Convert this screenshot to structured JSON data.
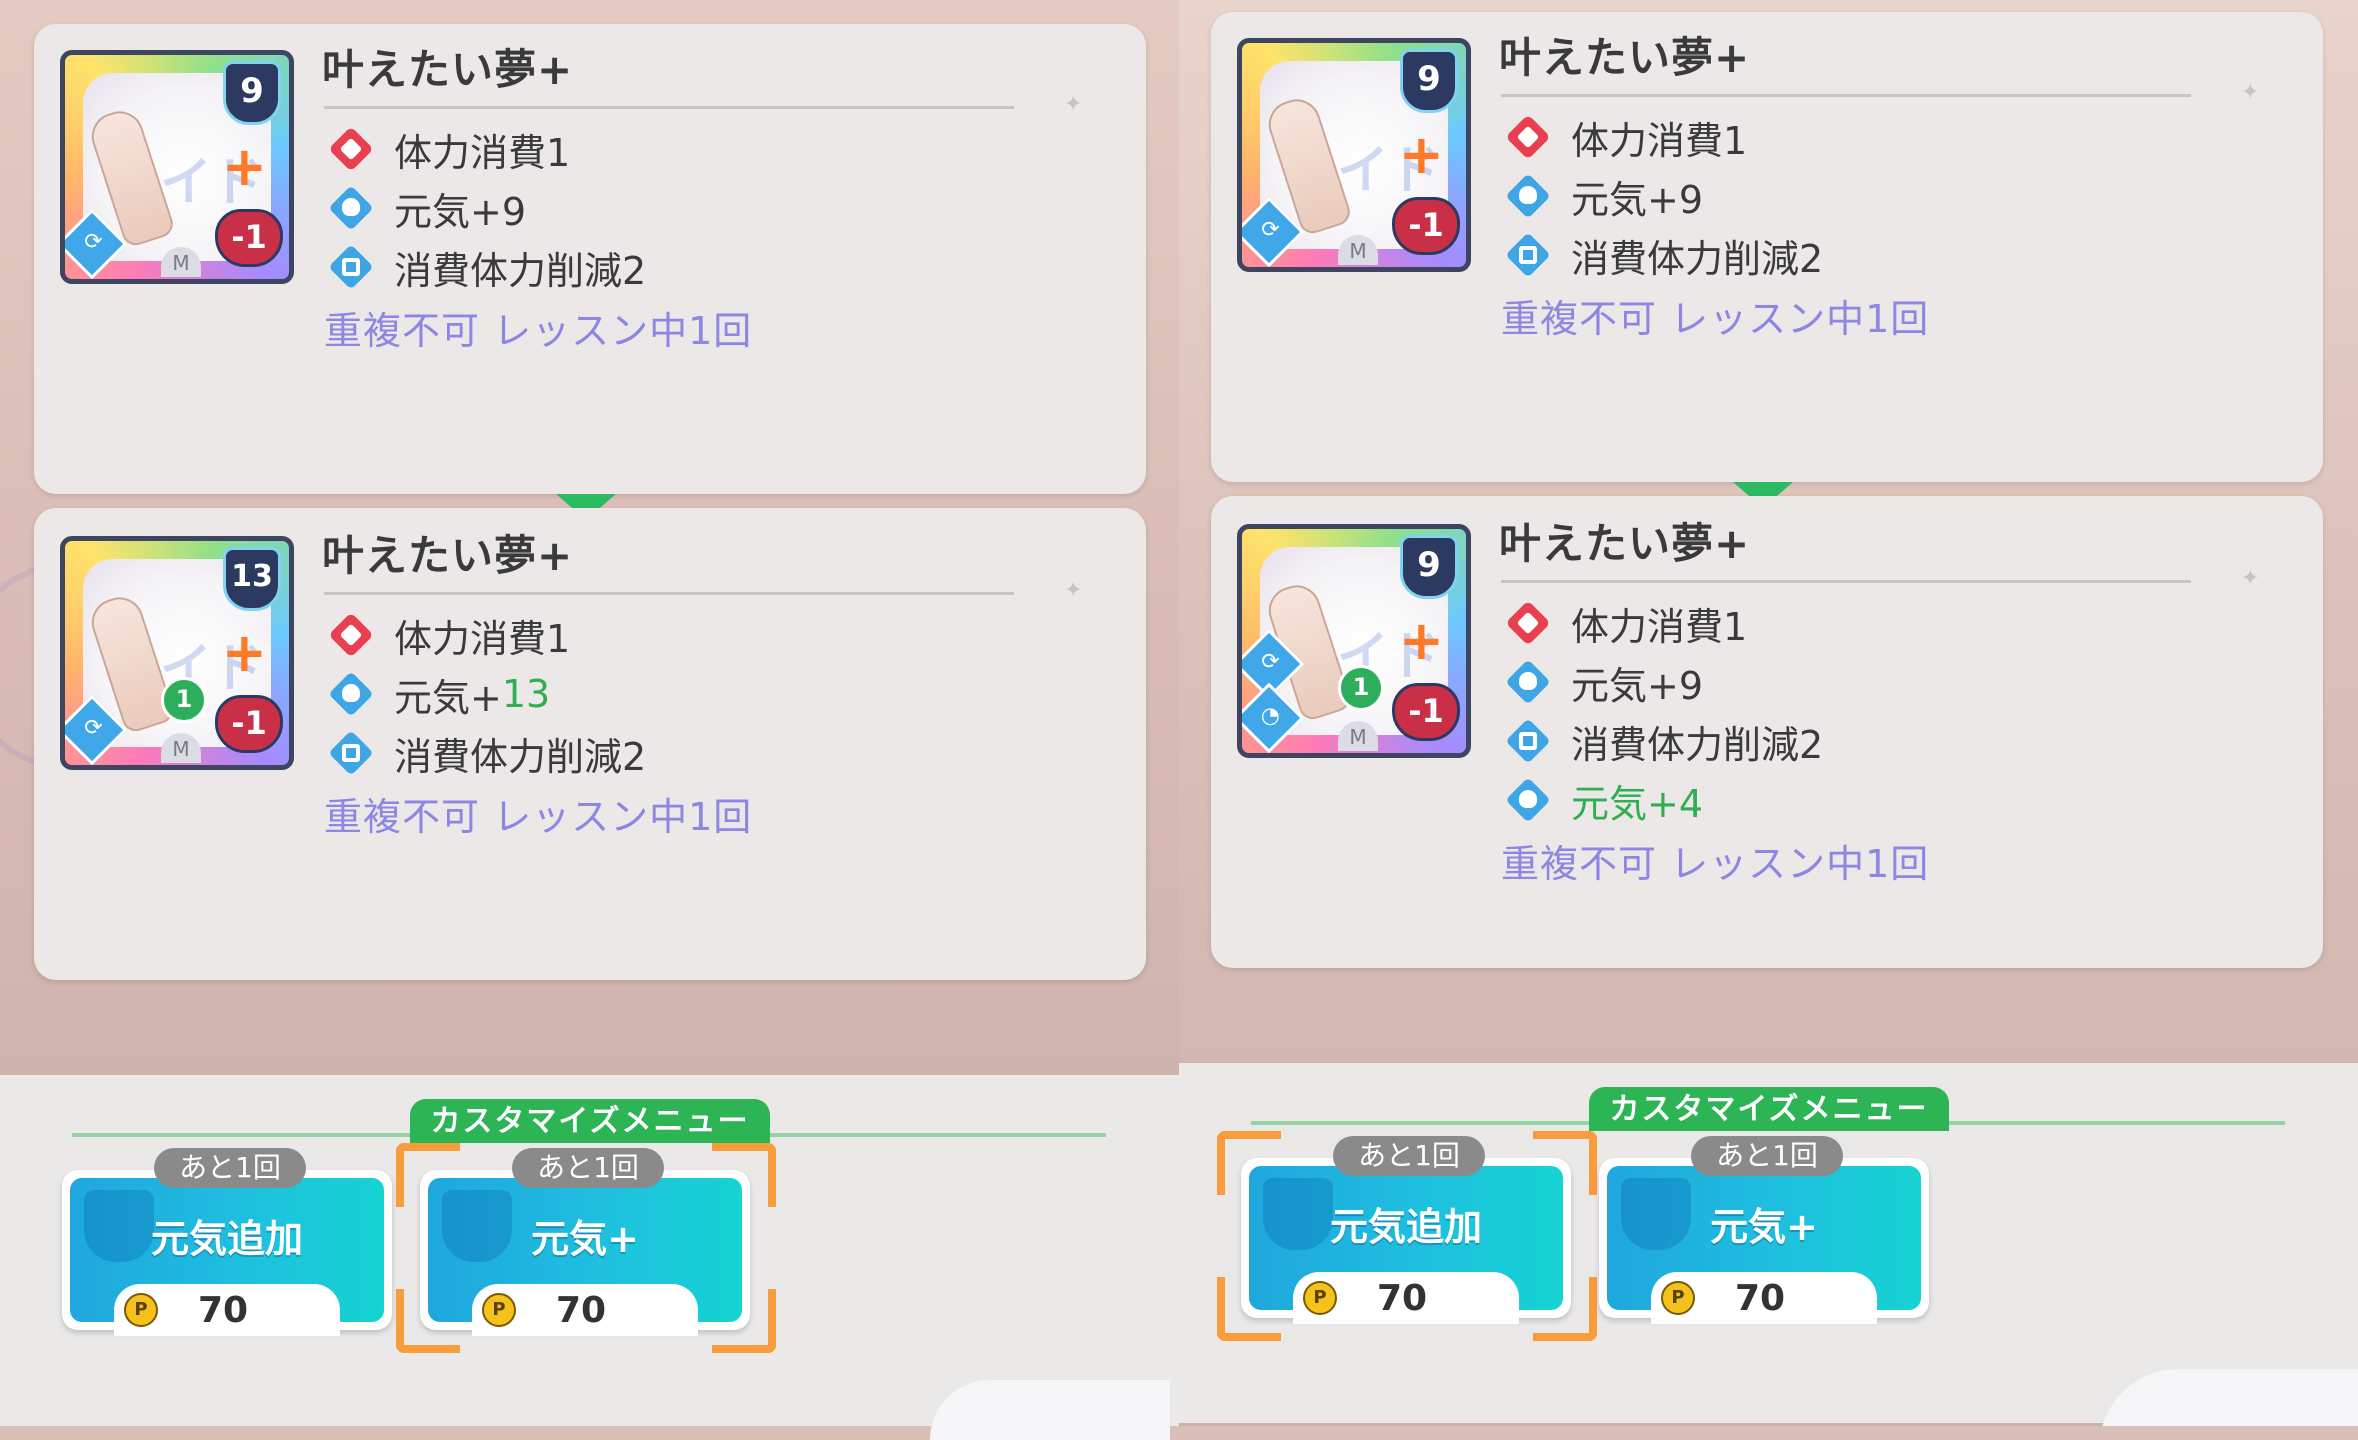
{
  "left_panel": {
    "card_before": {
      "name": "叶えたい夢+",
      "cost": "9",
      "damage": "-1",
      "rarity": "M",
      "effects": [
        {
          "icon": "heart-icon",
          "text": "体力消費1"
        },
        {
          "icon": "genki-icon",
          "text": "元気+9"
        },
        {
          "icon": "reduce-icon",
          "text": "消費体力削減2"
        }
      ],
      "condition": "重複不可 レッスン中1回"
    },
    "card_after": {
      "name": "叶えたい夢+",
      "cost": "13",
      "damage": "-1",
      "rarity": "M",
      "enhance_level": "1",
      "effects": [
        {
          "icon": "heart-icon",
          "text": "体力消費1"
        },
        {
          "icon": "genki-icon",
          "text": "元気+",
          "highlight": "13"
        },
        {
          "icon": "reduce-icon",
          "text": "消費体力削減2"
        }
      ],
      "condition": "重複不可 レッスン中1回"
    },
    "menu": {
      "title": "カスタマイズメニュー",
      "options": [
        {
          "label": "元気追加",
          "remaining": "あと1回",
          "price": "70",
          "selected": false
        },
        {
          "label": "元気+",
          "remaining": "あと1回",
          "price": "70",
          "selected": true
        }
      ]
    }
  },
  "right_panel": {
    "card_before": {
      "name": "叶えたい夢+",
      "cost": "9",
      "damage": "-1",
      "rarity": "M",
      "effects": [
        {
          "icon": "heart-icon",
          "text": "体力消費1"
        },
        {
          "icon": "genki-icon",
          "text": "元気+9"
        },
        {
          "icon": "reduce-icon",
          "text": "消費体力削減2"
        }
      ],
      "condition": "重複不可 レッスン中1回"
    },
    "card_after": {
      "name": "叶えたい夢+",
      "cost": "9",
      "damage": "-1",
      "rarity": "M",
      "enhance_level": "1",
      "effects": [
        {
          "icon": "heart-icon",
          "text": "体力消費1"
        },
        {
          "icon": "genki-icon",
          "text": "元気+9"
        },
        {
          "icon": "reduce-icon",
          "text": "消費体力削減2"
        },
        {
          "icon": "genki-icon",
          "text": "元気+4",
          "green": true
        }
      ],
      "condition": "重複不可 レッスン中1回"
    },
    "menu": {
      "title": "カスタマイズメニュー",
      "options": [
        {
          "label": "元気追加",
          "remaining": "あと1回",
          "price": "70",
          "selected": true
        },
        {
          "label": "元気+",
          "remaining": "あと1回",
          "price": "70",
          "selected": false
        }
      ]
    }
  },
  "colors": {
    "accent_green": "#2cb455",
    "condition_purple": "#8d86e3",
    "selector_orange": "#f89c3c",
    "button_cyan": "#1fbfdf"
  }
}
